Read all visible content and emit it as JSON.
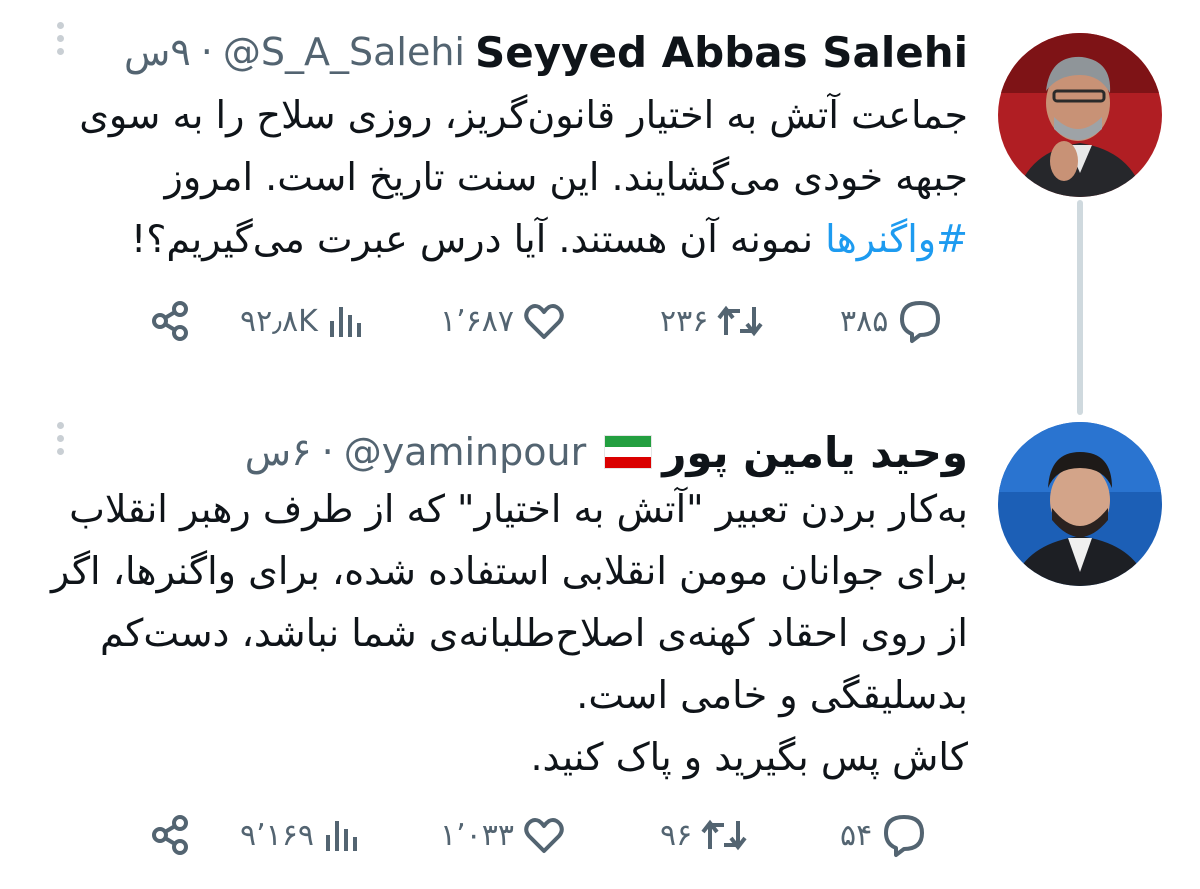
{
  "tweets": [
    {
      "display_name": "Seyyed Abbas Salehi",
      "handle": "@S_A_Salehi",
      "separator": "·",
      "time": "۹س",
      "body_lines": [
        "جماعت آتش به اختیار قانون‌گریز، روزی سلاح را به سوی",
        "جبهه خودی می‌گشایند. این سنت تاریخ است. امروز"
      ],
      "hashtag": "#واگنرها",
      "last_line_rest": " نمونه آن هستند. آیا درس عبرت می‌گیریم؟!",
      "replies": "۳۸۵",
      "retweets": "۲۳۶",
      "likes": "۱٬۶۸۷",
      "views": "۹۲٫۸K"
    },
    {
      "display_name": "وحید یامین پور",
      "handle": "@yaminpour",
      "separator": "·",
      "time": "۶س",
      "flag_icon": "iran-flag-icon",
      "body_lines": [
        "به‌کار بردن تعبیر \"آتش به اختیار\" که از طرف رهبر انقلاب",
        "برای جوانان مومن انقلابی استفاده شده، برای واگنرها، اگر",
        "از روی احقاد کهنه‌ی اصلاح‌طلبانه‌ی شما نباشد، دست‌کم",
        "بدسلیقگی و خامی است.",
        "کاش پس بگیرید و پاک کنید."
      ],
      "replies": "۵۴",
      "retweets": "۹۶",
      "likes": "۱٬۰۳۳",
      "views": "۹٬۱۶۹"
    }
  ],
  "colors": {
    "link": "#1d9bf0",
    "muted": "#536471",
    "text": "#0f1419",
    "thread_line": "#cfd9de"
  }
}
